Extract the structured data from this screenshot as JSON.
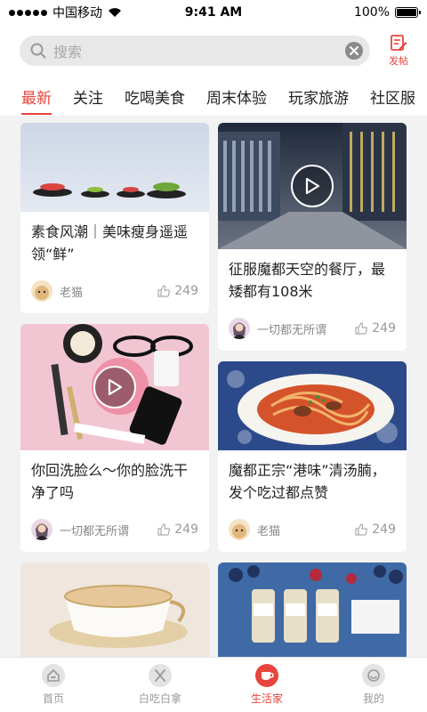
{
  "status_bar": {
    "carrier": "中国移动",
    "time": "9:41 AM",
    "battery": "100%",
    "battery_level": 1.0
  },
  "search": {
    "placeholder": "搜索",
    "post_label": "发帖"
  },
  "tabs": [
    "最新",
    "关注",
    "吃喝美食",
    "周末体验",
    "玩家旅游",
    "社区服"
  ],
  "active_tab": 0,
  "feed": {
    "left": [
      {
        "title": "素食风潮｜美味瘦身遥遥领“鲜”",
        "author": "老猫",
        "likes": "249",
        "video": false
      },
      {
        "title": "你回洗脸么～你的脸洗干净了吗",
        "author": "一切都无所谓",
        "likes": "249",
        "video": true
      },
      {
        "title": "",
        "author": "",
        "likes": "",
        "video": false
      }
    ],
    "right": [
      {
        "title": "征服魔都天空的餐厅，最矮都有108米",
        "author": "一切都无所谓",
        "likes": "249",
        "video": true
      },
      {
        "title": "魔都正宗“港味”清汤腩，发个吃过都点赞",
        "author": "老猫",
        "likes": "249",
        "video": false
      },
      {
        "title": "",
        "author": "",
        "likes": "",
        "video": false
      }
    ]
  },
  "bottom_nav": [
    {
      "label": "首页",
      "icon": "home-icon"
    },
    {
      "label": "白吃白拿",
      "icon": "cutlery-icon"
    },
    {
      "label": "生活家",
      "icon": "cup-icon"
    },
    {
      "label": "我的",
      "icon": "profile-icon"
    }
  ],
  "active_nav": 2,
  "colors": {
    "accent": "#e8453c",
    "muted": "#999999"
  }
}
